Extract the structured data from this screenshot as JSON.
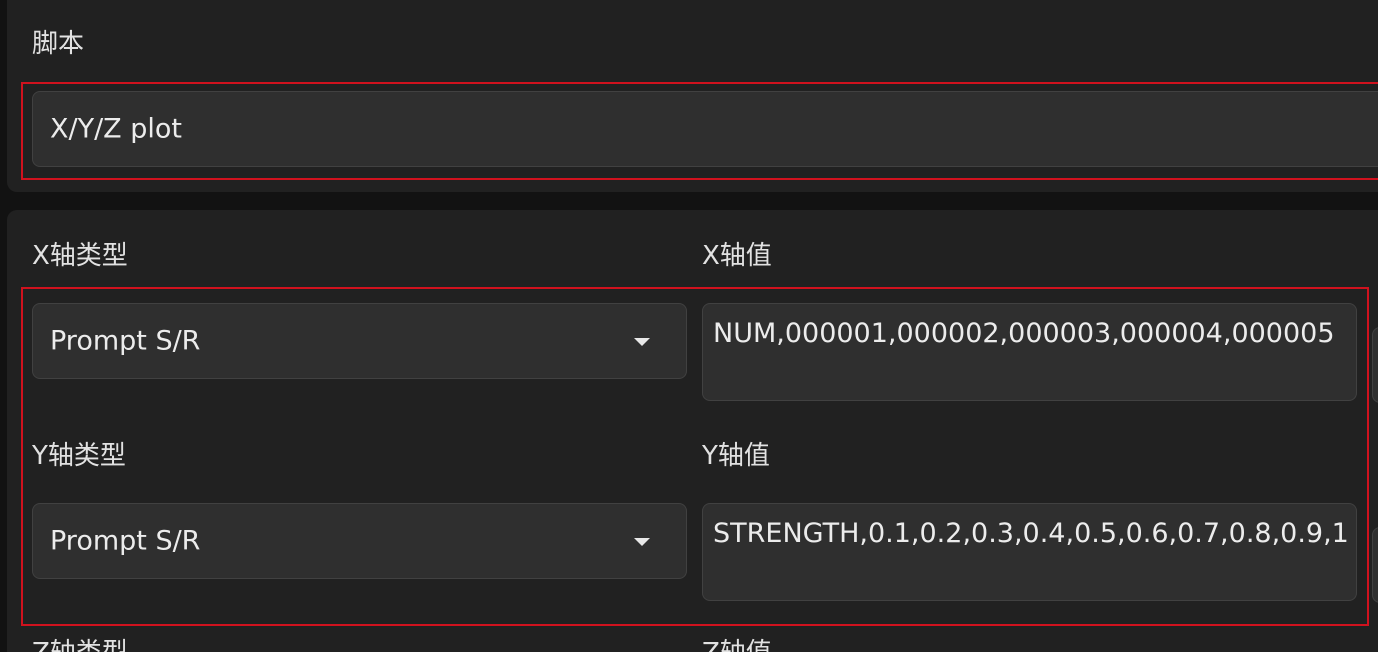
{
  "script": {
    "label": "脚本",
    "selected": "X/Y/Z plot"
  },
  "x_axis": {
    "type_label": "X轴类型",
    "type_value": "Prompt S/R",
    "values_label": "X轴值",
    "values_text": "NUM,000001,000002,000003,000004,000005"
  },
  "y_axis": {
    "type_label": "Y轴类型",
    "type_value": "Prompt S/R",
    "values_label": "Y轴值",
    "values_text": "STRENGTH,0.1,0.2,0.3,0.4,0.5,0.6,0.7,0.8,0.9,1"
  },
  "z_axis": {
    "type_label": "Z轴类型",
    "values_label": "Z轴值"
  },
  "colors": {
    "highlight": "#d0121e",
    "panel": "#212121",
    "field": "#2f2f2f"
  }
}
